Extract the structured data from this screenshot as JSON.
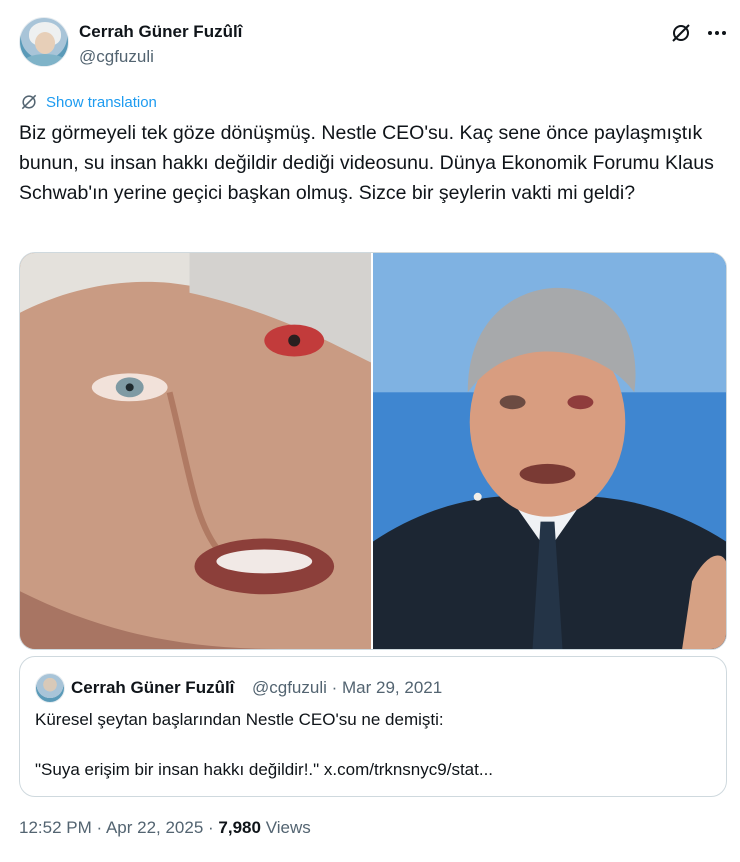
{
  "author": {
    "display_name": "Cerrah Güner Fuzûlî",
    "handle": "@cgfuzuli",
    "avatar_icon": "profile-avatar"
  },
  "actions": {
    "grok_icon": "grok-icon",
    "more_icon": "more-options-icon"
  },
  "translation": {
    "label": "Show translation",
    "icon": "translate-icon"
  },
  "tweet": {
    "text": "Biz görmeyeli tek göze dönüşmüş. Nestle CEO'su. Kaç sene önce paylaşmıştık bunun, su insan hakkı değildir dediği videosunu. Dünya Ekonomik Forumu Klaus Schwab'ın yerine geçici başkan olmuş. Sizce bir şeylerin vakti mi geldi?"
  },
  "media": {
    "count": 2
  },
  "quote": {
    "display_name": "Cerrah Güner Fuzûlî",
    "meta": "@cgfuzuli · Mar 29, 2021",
    "line1": "Küresel şeytan başlarından Nestle CEO'su ne demişti:",
    "line2": "\"Suya erişim bir insan hakkı değildir!.\" x.com/trknsnyc9/stat..."
  },
  "footer": {
    "time": "12:52 PM",
    "separator": " · ",
    "date": "Apr 22, 2025",
    "views_count": "7,980",
    "views_label": "Views"
  },
  "colors": {
    "link_blue": "#1d9bf0",
    "secondary_text": "#536471",
    "primary_text": "#0f1419",
    "border": "#cfd9de"
  }
}
